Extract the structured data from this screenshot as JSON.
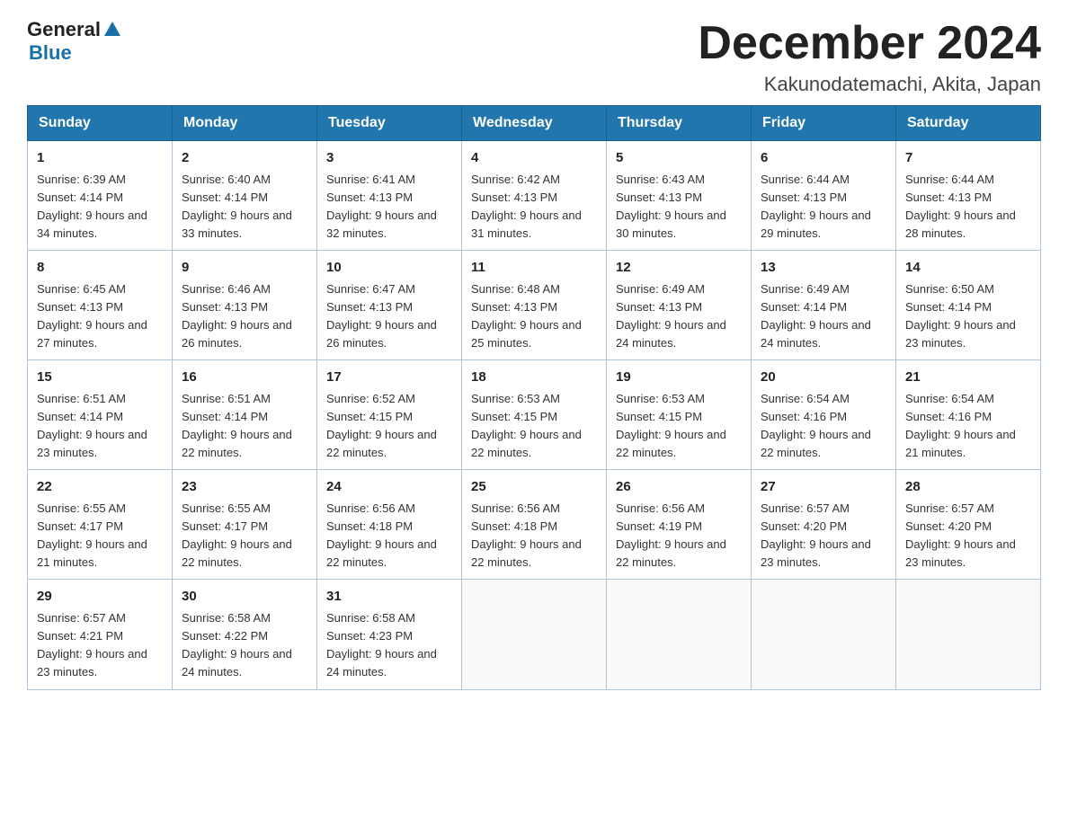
{
  "header": {
    "logo_general": "General",
    "logo_blue": "Blue",
    "month_title": "December 2024",
    "location": "Kakunodatemachi, Akita, Japan"
  },
  "days_of_week": [
    "Sunday",
    "Monday",
    "Tuesday",
    "Wednesday",
    "Thursday",
    "Friday",
    "Saturday"
  ],
  "weeks": [
    [
      {
        "day": "1",
        "sunrise": "6:39 AM",
        "sunset": "4:14 PM",
        "daylight": "9 hours and 34 minutes."
      },
      {
        "day": "2",
        "sunrise": "6:40 AM",
        "sunset": "4:14 PM",
        "daylight": "9 hours and 33 minutes."
      },
      {
        "day": "3",
        "sunrise": "6:41 AM",
        "sunset": "4:13 PM",
        "daylight": "9 hours and 32 minutes."
      },
      {
        "day": "4",
        "sunrise": "6:42 AM",
        "sunset": "4:13 PM",
        "daylight": "9 hours and 31 minutes."
      },
      {
        "day": "5",
        "sunrise": "6:43 AM",
        "sunset": "4:13 PM",
        "daylight": "9 hours and 30 minutes."
      },
      {
        "day": "6",
        "sunrise": "6:44 AM",
        "sunset": "4:13 PM",
        "daylight": "9 hours and 29 minutes."
      },
      {
        "day": "7",
        "sunrise": "6:44 AM",
        "sunset": "4:13 PM",
        "daylight": "9 hours and 28 minutes."
      }
    ],
    [
      {
        "day": "8",
        "sunrise": "6:45 AM",
        "sunset": "4:13 PM",
        "daylight": "9 hours and 27 minutes."
      },
      {
        "day": "9",
        "sunrise": "6:46 AM",
        "sunset": "4:13 PM",
        "daylight": "9 hours and 26 minutes."
      },
      {
        "day": "10",
        "sunrise": "6:47 AM",
        "sunset": "4:13 PM",
        "daylight": "9 hours and 26 minutes."
      },
      {
        "day": "11",
        "sunrise": "6:48 AM",
        "sunset": "4:13 PM",
        "daylight": "9 hours and 25 minutes."
      },
      {
        "day": "12",
        "sunrise": "6:49 AM",
        "sunset": "4:13 PM",
        "daylight": "9 hours and 24 minutes."
      },
      {
        "day": "13",
        "sunrise": "6:49 AM",
        "sunset": "4:14 PM",
        "daylight": "9 hours and 24 minutes."
      },
      {
        "day": "14",
        "sunrise": "6:50 AM",
        "sunset": "4:14 PM",
        "daylight": "9 hours and 23 minutes."
      }
    ],
    [
      {
        "day": "15",
        "sunrise": "6:51 AM",
        "sunset": "4:14 PM",
        "daylight": "9 hours and 23 minutes."
      },
      {
        "day": "16",
        "sunrise": "6:51 AM",
        "sunset": "4:14 PM",
        "daylight": "9 hours and 22 minutes."
      },
      {
        "day": "17",
        "sunrise": "6:52 AM",
        "sunset": "4:15 PM",
        "daylight": "9 hours and 22 minutes."
      },
      {
        "day": "18",
        "sunrise": "6:53 AM",
        "sunset": "4:15 PM",
        "daylight": "9 hours and 22 minutes."
      },
      {
        "day": "19",
        "sunrise": "6:53 AM",
        "sunset": "4:15 PM",
        "daylight": "9 hours and 22 minutes."
      },
      {
        "day": "20",
        "sunrise": "6:54 AM",
        "sunset": "4:16 PM",
        "daylight": "9 hours and 22 minutes."
      },
      {
        "day": "21",
        "sunrise": "6:54 AM",
        "sunset": "4:16 PM",
        "daylight": "9 hours and 21 minutes."
      }
    ],
    [
      {
        "day": "22",
        "sunrise": "6:55 AM",
        "sunset": "4:17 PM",
        "daylight": "9 hours and 21 minutes."
      },
      {
        "day": "23",
        "sunrise": "6:55 AM",
        "sunset": "4:17 PM",
        "daylight": "9 hours and 22 minutes."
      },
      {
        "day": "24",
        "sunrise": "6:56 AM",
        "sunset": "4:18 PM",
        "daylight": "9 hours and 22 minutes."
      },
      {
        "day": "25",
        "sunrise": "6:56 AM",
        "sunset": "4:18 PM",
        "daylight": "9 hours and 22 minutes."
      },
      {
        "day": "26",
        "sunrise": "6:56 AM",
        "sunset": "4:19 PM",
        "daylight": "9 hours and 22 minutes."
      },
      {
        "day": "27",
        "sunrise": "6:57 AM",
        "sunset": "4:20 PM",
        "daylight": "9 hours and 23 minutes."
      },
      {
        "day": "28",
        "sunrise": "6:57 AM",
        "sunset": "4:20 PM",
        "daylight": "9 hours and 23 minutes."
      }
    ],
    [
      {
        "day": "29",
        "sunrise": "6:57 AM",
        "sunset": "4:21 PM",
        "daylight": "9 hours and 23 minutes."
      },
      {
        "day": "30",
        "sunrise": "6:58 AM",
        "sunset": "4:22 PM",
        "daylight": "9 hours and 24 minutes."
      },
      {
        "day": "31",
        "sunrise": "6:58 AM",
        "sunset": "4:23 PM",
        "daylight": "9 hours and 24 minutes."
      },
      null,
      null,
      null,
      null
    ]
  ]
}
